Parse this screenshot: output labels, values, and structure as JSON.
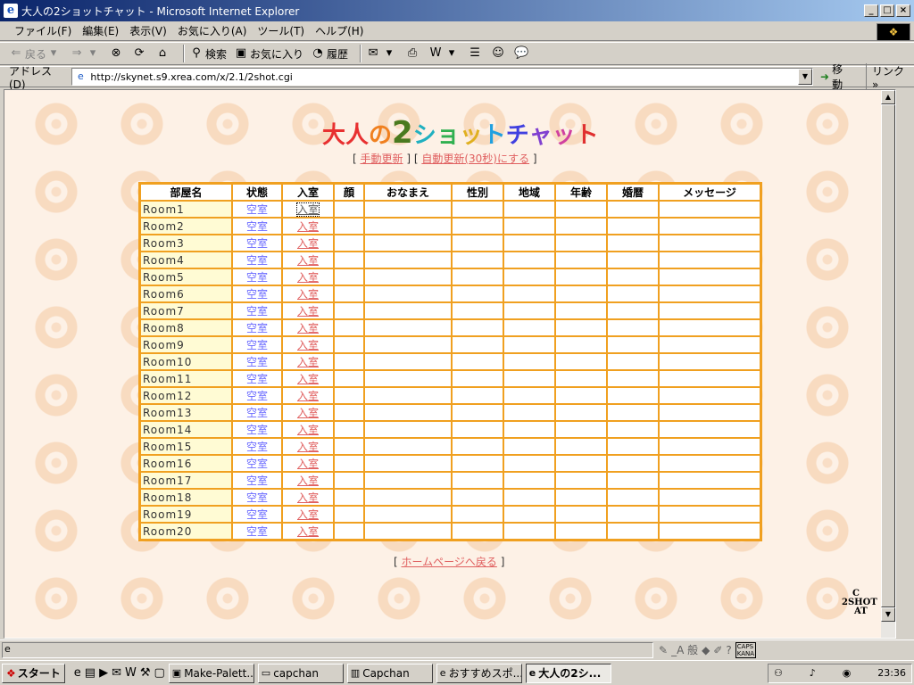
{
  "window": {
    "title": "大人の2ショットチャット - Microsoft Internet Explorer",
    "buttons": {
      "minimize": "_",
      "maximize": "□",
      "close": "×"
    }
  },
  "menu": [
    "ファイル(F)",
    "編集(E)",
    "表示(V)",
    "お気に入り(A)",
    "ツール(T)",
    "ヘルプ(H)"
  ],
  "toolbar": {
    "back": "戻る",
    "search": "検索",
    "favorites": "お気に入り",
    "history": "履歴"
  },
  "address": {
    "label": "アドレス(D)",
    "url": "http://skynet.s9.xrea.com/x/2.1/2shot.cgi",
    "go": "移動",
    "links": "リンク »"
  },
  "page": {
    "title_parts": [
      {
        "text": "大",
        "color": "#e83030"
      },
      {
        "text": "人",
        "color": "#e83030"
      },
      {
        "text": "の",
        "color": "#f08020"
      },
      {
        "text": "2",
        "color": "#4a7a20",
        "big": true
      },
      {
        "text": "シ",
        "color": "#20b0c0"
      },
      {
        "text": "ョ",
        "color": "#30b050"
      },
      {
        "text": "ッ",
        "color": "#e0b020"
      },
      {
        "text": "ト",
        "color": "#20a0e0"
      },
      {
        "text": "チ",
        "color": "#4040e0"
      },
      {
        "text": "ャ",
        "color": "#8040d0"
      },
      {
        "text": "ッ",
        "color": "#d040a0"
      },
      {
        "text": "ト",
        "color": "#e03030"
      }
    ],
    "manual_refresh": "手動更新",
    "auto_refresh": "自動更新(30秒)にする",
    "columns": [
      "部屋名",
      "状態",
      "入室",
      "顔",
      "おなまえ",
      "性別",
      "地域",
      "年齢",
      "婚暦",
      "メッセージ"
    ],
    "rooms": [
      {
        "name": "Room1",
        "state": "空室",
        "enter": "入室"
      },
      {
        "name": "Room2",
        "state": "空室",
        "enter": "入室"
      },
      {
        "name": "Room3",
        "state": "空室",
        "enter": "入室"
      },
      {
        "name": "Room4",
        "state": "空室",
        "enter": "入室"
      },
      {
        "name": "Room5",
        "state": "空室",
        "enter": "入室"
      },
      {
        "name": "Room6",
        "state": "空室",
        "enter": "入室"
      },
      {
        "name": "Room7",
        "state": "空室",
        "enter": "入室"
      },
      {
        "name": "Room8",
        "state": "空室",
        "enter": "入室"
      },
      {
        "name": "Room9",
        "state": "空室",
        "enter": "入室"
      },
      {
        "name": "Room10",
        "state": "空室",
        "enter": "入室"
      },
      {
        "name": "Room11",
        "state": "空室",
        "enter": "入室"
      },
      {
        "name": "Room12",
        "state": "空室",
        "enter": "入室"
      },
      {
        "name": "Room13",
        "state": "空室",
        "enter": "入室"
      },
      {
        "name": "Room14",
        "state": "空室",
        "enter": "入室"
      },
      {
        "name": "Room15",
        "state": "空室",
        "enter": "入室"
      },
      {
        "name": "Room16",
        "state": "空室",
        "enter": "入室"
      },
      {
        "name": "Room17",
        "state": "空室",
        "enter": "入室"
      },
      {
        "name": "Room18",
        "state": "空室",
        "enter": "入室"
      },
      {
        "name": "Room19",
        "state": "空室",
        "enter": "入室"
      },
      {
        "name": "Room20",
        "state": "空室",
        "enter": "入室"
      }
    ],
    "back_home": "ホームページへ戻る",
    "logo_lines": [
      "C",
      "2SHOT",
      "AT"
    ]
  },
  "statusbar": {
    "ime": "_A 般",
    "caps": "CAPS",
    "kana": "KANA"
  },
  "taskbar": {
    "start": "スタート",
    "tasks": [
      {
        "label": "Make-Palett...",
        "active": false
      },
      {
        "label": "capchan",
        "active": false
      },
      {
        "label": "Capchan",
        "active": false
      },
      {
        "label": "おすすめスポ...",
        "active": false
      },
      {
        "label": "大人の2シ...",
        "active": true
      }
    ],
    "clock": "23:36"
  },
  "colors": {
    "table_border": "#f0a020",
    "name_cell_bg": "#fffbd4",
    "link": "#e06060",
    "state_text": "#6a6aff",
    "page_bg": "#fdf1e6"
  }
}
